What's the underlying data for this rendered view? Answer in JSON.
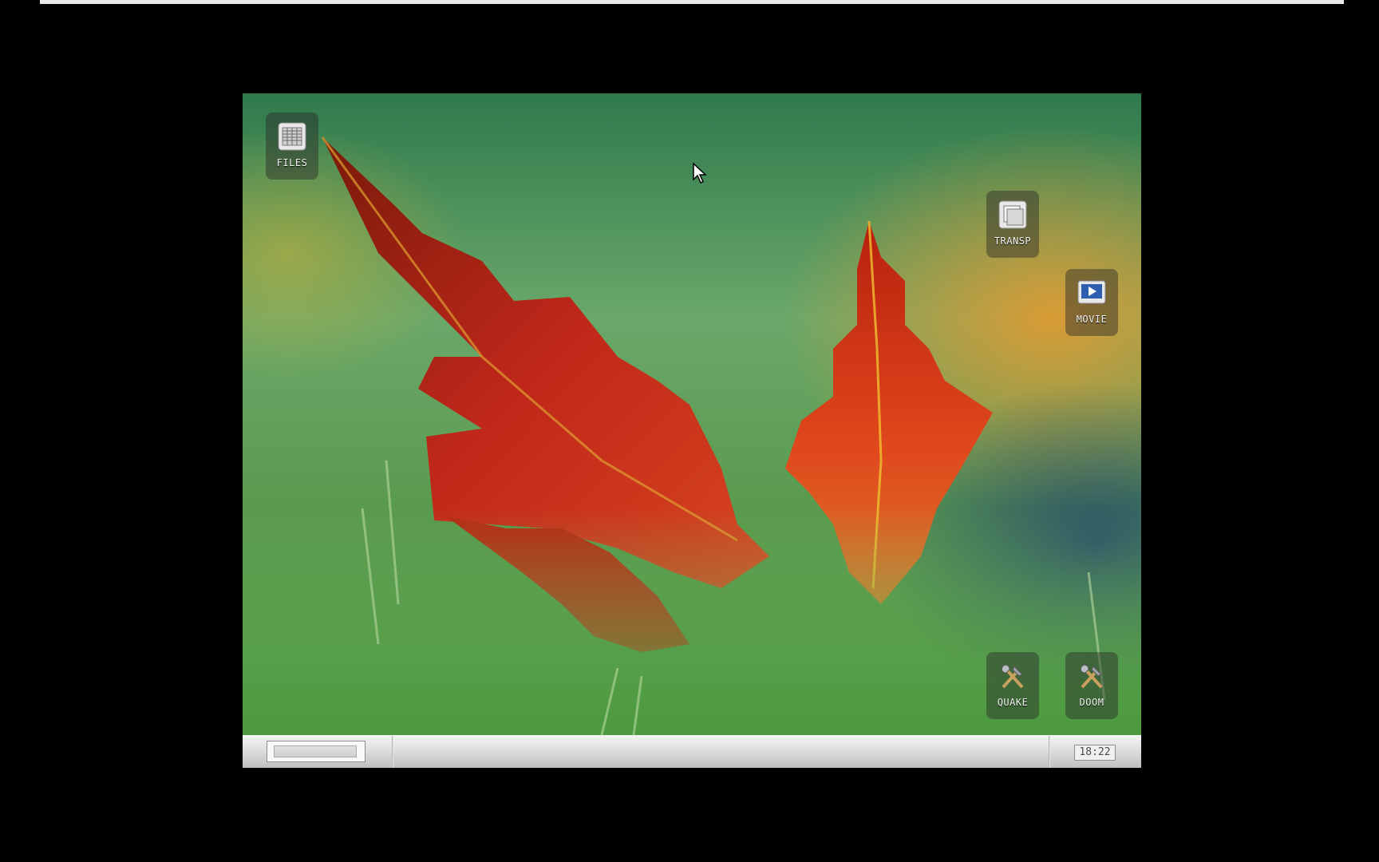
{
  "desktop": {
    "icons": [
      {
        "label": "FILES",
        "icon": "files-icon"
      },
      {
        "label": "TRANSP",
        "icon": "transparency-icon"
      },
      {
        "label": "MOVIE",
        "icon": "movie-icon"
      },
      {
        "label": "QUAKE",
        "icon": "tools-icon"
      },
      {
        "label": "DOOM",
        "icon": "tools-icon"
      }
    ]
  },
  "taskbar": {
    "clock": "18:22"
  },
  "colors": {
    "background": "#000000",
    "taskbar": "#d8d8d8",
    "icon_label": "#f4f4f4"
  }
}
